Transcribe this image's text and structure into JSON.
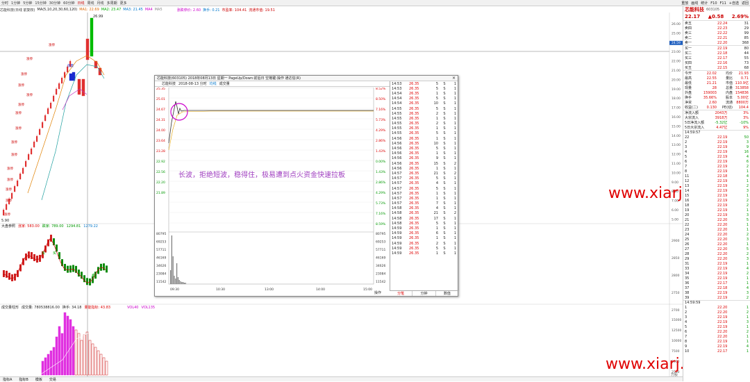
{
  "topbar": {
    "tabs": [
      "分时",
      "1分钟",
      "5分钟",
      "15分钟",
      "30分钟",
      "60分钟",
      "日线",
      "周线",
      "月线",
      "多周期",
      "更多"
    ],
    "active_tab": 6,
    "right_items": [
      "重放",
      "画线",
      "统计",
      "F10",
      "F11",
      "+自选",
      "返回"
    ]
  },
  "infobar": {
    "name": "芯能科技(日线 前复权)",
    "ma_values": "MA(5,10,20,30,60,120)",
    "ma1": "MA1: 22.69",
    "ma2": "MA2: 23.47",
    "ma3": "MA3: 21.45",
    "ma4": "MA4",
    "ma5": "MA5",
    "extra1": "涨跌停价: 2.60",
    "extra2": "换手: 0.21",
    "extra3": "市盈率: 104.41",
    "extra4": "流通市值: 19.51"
  },
  "chart_main": {
    "y_labels": [
      "26.00",
      "25.00",
      "24.59",
      "23.00",
      "22.00",
      "21.00",
      "20.00",
      "19.00",
      "18.00",
      "17.00",
      "16.00",
      "15.00",
      "14.00",
      "13.00",
      "12.00",
      "11.00",
      "10.00",
      "9.00",
      "8.00",
      "7.00",
      "6.00",
      "5.00"
    ],
    "high_label": "26.99",
    "low_label": "5.90",
    "labels_in_chart": [
      "放量",
      "涨停",
      "涨停",
      "涨停",
      "涨停",
      "涨停",
      "涨停",
      "涨停",
      "涨停",
      "涨停",
      "涨停",
      "涨停",
      "涨停",
      "涨停",
      "涨停",
      "涨停"
    ]
  },
  "chart_index": {
    "title": "大盘参照",
    "v1": "涨家: 583.00",
    "v2": "跌家: 789.00",
    "v3": "1294.81",
    "v4": "1279.22",
    "y_labels": [
      "2900",
      "2850",
      "2800",
      "2750",
      "2700"
    ],
    "badges": [
      "买",
      "买",
      "卖"
    ]
  },
  "chart_vol": {
    "title": "成交量柱形",
    "v1": "成交量: 780538816.00",
    "v2": "换手: 34.18",
    "v3": "量能指标: 43.83",
    "v4": "VOL40",
    "v5": "VOL135",
    "y_labels": [
      "15000",
      "12500",
      "10000",
      "7500",
      "5000",
      "2500"
    ],
    "unit": "万股"
  },
  "popup": {
    "title": "芯能科技(603105)  2018年08月13日 星期一 PageUp/Down:前后日 空格键:操作  通达信(R)",
    "sub_name": "芯能科技",
    "sub_date": "2018-08-13 分时",
    "sub_tag": "均线",
    "sub_vol": "成交量",
    "close": "×",
    "left_prices": [
      "25.35",
      "25.01",
      "24.67",
      "24.31",
      "24.00",
      "23.64",
      "23.28",
      "22.92",
      "22.56",
      "22.20",
      "21.89"
    ],
    "right_pcts": [
      "8.52%",
      "8.50%",
      "7.16%",
      "5.73%",
      "4.29%",
      "2.86%",
      "1.43%",
      "0.00%",
      "1.43%",
      "2.86%",
      "4.29%",
      "5.73%",
      "7.16%",
      "8.59%"
    ],
    "vol_labels": [
      "80795",
      "69253",
      "57711",
      "46169",
      "34626",
      "23084",
      "11542"
    ],
    "time_labels": [
      "09:30",
      "10:30",
      "13:00",
      "14:00",
      "15:00"
    ],
    "sidebar_label": "操作",
    "tabs": [
      "分笔",
      "分钟",
      "数值"
    ],
    "ticks": [
      {
        "t": "14:53",
        "p": "26.35",
        "v": "5",
        "s": "S",
        "n": "1"
      },
      {
        "t": "14:53",
        "p": "26.35",
        "v": "5",
        "s": "S",
        "n": "1"
      },
      {
        "t": "14:54",
        "p": "26.35",
        "v": "1",
        "s": "S",
        "n": "1"
      },
      {
        "t": "14:54",
        "p": "26.35",
        "v": "5",
        "s": "S",
        "n": "1"
      },
      {
        "t": "14:54",
        "p": "26.35",
        "v": "10",
        "s": "S",
        "n": "1"
      },
      {
        "t": "14:55",
        "p": "26.35",
        "v": "5",
        "s": "S",
        "n": "1"
      },
      {
        "t": "14:55",
        "p": "26.35",
        "v": "2",
        "s": "S",
        "n": "1"
      },
      {
        "t": "14:55",
        "p": "26.35",
        "v": "1",
        "s": "S",
        "n": "1"
      },
      {
        "t": "14:55",
        "p": "26.35",
        "v": "2",
        "s": "S",
        "n": "1"
      },
      {
        "t": "14:55",
        "p": "26.35",
        "v": "1",
        "s": "S",
        "n": "1"
      },
      {
        "t": "14:55",
        "p": "26.35",
        "v": "5",
        "s": "S",
        "n": "1"
      },
      {
        "t": "14:56",
        "p": "26.35",
        "v": "1",
        "s": "S",
        "n": "1"
      },
      {
        "t": "14:56",
        "p": "26.35",
        "v": "10",
        "s": "S",
        "n": "1"
      },
      {
        "t": "14:56",
        "p": "26.35",
        "v": "5",
        "s": "S",
        "n": "1"
      },
      {
        "t": "14:56",
        "p": "26.35",
        "v": "1",
        "s": "S",
        "n": "1"
      },
      {
        "t": "14:56",
        "p": "26.35",
        "v": "9",
        "s": "S",
        "n": "1"
      },
      {
        "t": "14:56",
        "p": "26.35",
        "v": "15",
        "s": "S",
        "n": "2"
      },
      {
        "t": "14:56",
        "p": "26.35",
        "v": "1",
        "s": "S",
        "n": "1"
      },
      {
        "t": "14:57",
        "p": "26.35",
        "v": "21",
        "s": "S",
        "n": "2"
      },
      {
        "t": "14:57",
        "p": "26.35",
        "v": "5",
        "s": "S",
        "n": "1"
      },
      {
        "t": "14:57",
        "p": "26.35",
        "v": "4",
        "s": "S",
        "n": "1"
      },
      {
        "t": "14:57",
        "p": "26.35",
        "v": "5",
        "s": "S",
        "n": "1"
      },
      {
        "t": "14:57",
        "p": "26.35",
        "v": "1",
        "s": "S",
        "n": "1"
      },
      {
        "t": "14:57",
        "p": "26.35",
        "v": "1",
        "s": "S",
        "n": "1"
      },
      {
        "t": "14:57",
        "p": "26.35",
        "v": "7",
        "s": "S",
        "n": "1"
      },
      {
        "t": "14:58",
        "p": "26.35",
        "v": "4",
        "s": "S",
        "n": "1"
      },
      {
        "t": "14:58",
        "p": "26.35",
        "v": "21",
        "s": "S",
        "n": "2"
      },
      {
        "t": "14:58",
        "p": "26.35",
        "v": "17",
        "s": "S",
        "n": "1"
      },
      {
        "t": "14:58",
        "p": "26.35",
        "v": "5",
        "s": "S",
        "n": "1"
      },
      {
        "t": "14:59",
        "p": "26.35",
        "v": "1",
        "s": "S",
        "n": "1"
      },
      {
        "t": "14:59",
        "p": "26.35",
        "v": "6",
        "s": "S",
        "n": "1"
      },
      {
        "t": "14:59",
        "p": "26.35",
        "v": "1",
        "s": "S",
        "n": "1"
      },
      {
        "t": "14:59",
        "p": "26.35",
        "v": "2",
        "s": "S",
        "n": "1"
      },
      {
        "t": "14:59",
        "p": "26.35",
        "v": "5",
        "s": "S",
        "n": "1"
      },
      {
        "t": "14:59",
        "p": "26.35",
        "v": "1",
        "s": "S",
        "n": "1"
      }
    ]
  },
  "annotation": "长波，拒绝短波，稳得住，极易遭到点火资金快速拉板",
  "watermark": "www.xiarj.com",
  "right_panel": {
    "name": "芯能科技",
    "code": "603105",
    "price": "22.17",
    "change": "▲0.58",
    "pct": "2.69%",
    "sells": [
      {
        "l": "卖五",
        "p": "22.24",
        "v": "31"
      },
      {
        "l": "卖四",
        "p": "22.23",
        "v": "29"
      },
      {
        "l": "卖三",
        "p": "22.22",
        "v": "99"
      },
      {
        "l": "卖二",
        "p": "22.21",
        "v": "85"
      },
      {
        "l": "卖一",
        "p": "22.20",
        "v": "368"
      }
    ],
    "buys": [
      {
        "l": "买一",
        "p": "22.19",
        "v": "80"
      },
      {
        "l": "买二",
        "p": "22.18",
        "v": "44"
      },
      {
        "l": "买三",
        "p": "22.17",
        "v": "55"
      },
      {
        "l": "买四",
        "p": "22.16",
        "v": "73"
      },
      {
        "l": "买五",
        "p": "22.15",
        "v": "68"
      }
    ],
    "stats": [
      {
        "a": "今开",
        "b": "22.02",
        "c": "均价",
        "d": "21.93"
      },
      {
        "a": "最高",
        "b": "22.55",
        "c": "量比",
        "d": "0.71"
      },
      {
        "a": "最低",
        "b": "21.21",
        "c": "市值",
        "d": "110.9亿"
      },
      {
        "a": "现量",
        "b": "28",
        "c": "总量",
        "d": "313858"
      },
      {
        "a": "外盘",
        "b": "159003",
        "c": "内盘",
        "d": "154836"
      },
      {
        "a": "换手",
        "b": "35.66%",
        "c": "股本",
        "d": "5.00亿"
      },
      {
        "a": "净资",
        "b": "2.60",
        "c": "流通",
        "d": "8800万"
      },
      {
        "a": "收益(二)",
        "b": "0.130",
        "c": "PE(动)",
        "d": "104.4"
      }
    ],
    "flows": [
      {
        "a": "净流入额",
        "b": "2043万",
        "c": "3%"
      },
      {
        "a": "大宗流入",
        "b": "3918万",
        "c": "3%"
      },
      {
        "a": "5日净流入额",
        "b": "-5.32亿",
        "c": "-10%"
      },
      {
        "a": "5日大宗流入",
        "b": "4.47亿",
        "c": "9%"
      }
    ],
    "tick_head": "14:59:57",
    "ticks": [
      {
        "a": "22",
        "p": "22.19",
        "v": "50"
      },
      {
        "a": "2",
        "p": "22.19",
        "v": "3"
      },
      {
        "a": "3",
        "p": "22.19",
        "v": "9"
      },
      {
        "a": "4",
        "p": "22.19",
        "v": "16"
      },
      {
        "a": "5",
        "p": "22.19",
        "v": "4"
      },
      {
        "a": "6",
        "p": "22.19",
        "v": "6"
      },
      {
        "a": "7",
        "p": "22.19",
        "v": "2"
      },
      {
        "a": "8",
        "p": "22.19",
        "v": "1"
      },
      {
        "a": "11",
        "p": "22.18",
        "v": "4"
      },
      {
        "a": "12",
        "p": "22.19",
        "v": "1"
      },
      {
        "a": "13",
        "p": "22.19",
        "v": "2"
      },
      {
        "a": "14",
        "p": "22.19",
        "v": "3"
      },
      {
        "a": "15",
        "p": "22.19",
        "v": "1"
      },
      {
        "a": "16",
        "p": "22.19",
        "v": "2"
      },
      {
        "a": "18",
        "p": "22.19",
        "v": "2"
      },
      {
        "a": "19",
        "p": "22.19",
        "v": "1"
      },
      {
        "a": "20",
        "p": "22.19",
        "v": "3"
      },
      {
        "a": "21",
        "p": "22.20",
        "v": "5"
      },
      {
        "a": "22",
        "p": "22.20",
        "v": "1"
      },
      {
        "a": "23",
        "p": "22.20",
        "v": "1"
      },
      {
        "a": "24",
        "p": "22.20",
        "v": "2"
      },
      {
        "a": "25",
        "p": "22.20",
        "v": "3"
      },
      {
        "a": "26",
        "p": "22.20",
        "v": "1"
      },
      {
        "a": "27",
        "p": "22.20",
        "v": "5"
      },
      {
        "a": "28",
        "p": "22.20",
        "v": "2"
      },
      {
        "a": "29",
        "p": "22.20",
        "v": "3"
      },
      {
        "a": "31",
        "p": "22.19",
        "v": "1"
      },
      {
        "a": "33",
        "p": "22.19",
        "v": "4"
      },
      {
        "a": "34",
        "p": "22.19",
        "v": "2"
      },
      {
        "a": "35",
        "p": "22.19",
        "v": "1"
      },
      {
        "a": "36",
        "p": "22.17",
        "v": "1"
      },
      {
        "a": "37",
        "p": "22.18",
        "v": "4"
      },
      {
        "a": "38",
        "p": "22.19",
        "v": "3"
      },
      {
        "a": "39",
        "p": "22.19",
        "v": "2"
      }
    ],
    "tick_head2": "14:59:59",
    "ticks2": [
      {
        "a": "1",
        "p": "22.20",
        "v": "1"
      },
      {
        "a": "2",
        "p": "22.20",
        "v": "2"
      },
      {
        "a": "3",
        "p": "22.19",
        "v": "1"
      },
      {
        "a": "4",
        "p": "22.19",
        "v": "3"
      },
      {
        "a": "5",
        "p": "22.19",
        "v": "1"
      },
      {
        "a": "6",
        "p": "22.20",
        "v": "2"
      },
      {
        "a": "7",
        "p": "22.20",
        "v": "1"
      },
      {
        "a": "8",
        "p": "22.19",
        "v": "1"
      },
      {
        "a": "9",
        "p": "22.19",
        "v": "4"
      },
      {
        "a": "10",
        "p": "22.17",
        "v": "1"
      }
    ]
  },
  "bottombar": {
    "items": [
      "指标A",
      "指标B",
      "模板",
      "交易"
    ]
  }
}
